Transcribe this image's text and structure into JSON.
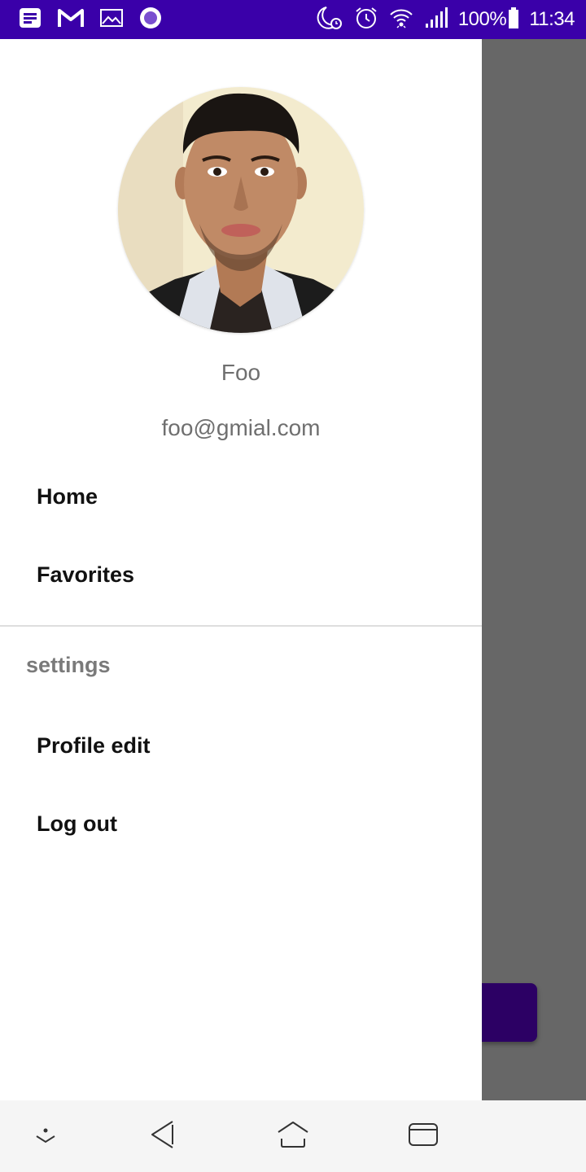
{
  "status_bar": {
    "left_icons": [
      "notes-icon",
      "gmail-icon",
      "gallery-icon",
      "record-icon"
    ],
    "right_icons": [
      "do-not-disturb-moon-icon",
      "alarm-clock-icon",
      "wifi-icon",
      "signal-icon",
      "battery-icon"
    ],
    "battery": "100%",
    "time": "11:34",
    "background_color": "#3a00a9"
  },
  "drawer": {
    "profile": {
      "name": "Foo",
      "email": "foo@gmial.com"
    },
    "primary_items": [
      {
        "label": "Home"
      },
      {
        "label": "Favorites"
      }
    ],
    "section_header": "settings",
    "settings_items": [
      {
        "label": "Profile edit"
      },
      {
        "label": "Log out"
      }
    ]
  },
  "nav_bar": {
    "buttons": [
      "hide-keyboard-icon",
      "back-icon",
      "home-icon",
      "recents-icon"
    ]
  }
}
